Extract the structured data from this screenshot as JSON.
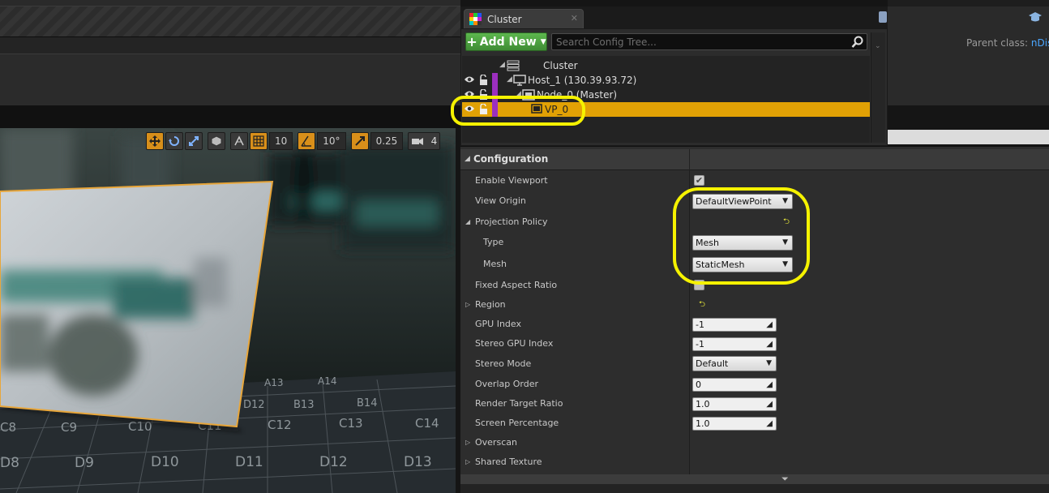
{
  "cluster_window": {
    "tab_title": "Cluster",
    "add_new_label": "Add New",
    "search_placeholder": "Search Config Tree...",
    "tree": [
      {
        "label": "Cluster",
        "depth": 0
      },
      {
        "label": "Host_1 (130.39.93.72)",
        "depth": 1
      },
      {
        "label": "Node_0 (Master)",
        "depth": 2
      },
      {
        "label": "VP_0",
        "depth": 3,
        "selected": true
      }
    ],
    "selected_color": "#e1a105",
    "swatch_color": "#9c2fbf"
  },
  "header_right": {
    "parent_class_label": "Parent class:",
    "parent_class_value": "nDis"
  },
  "viewport_toolbar": {
    "grid_snap": "10",
    "rotation_snap": "10°",
    "scale_snap": "0.25",
    "camera_speed": "4"
  },
  "viewport_floor": {
    "tiles": [
      "A13",
      "A14",
      "D12",
      "B13",
      "B14",
      "C8",
      "C9",
      "C10",
      "C11",
      "C12",
      "C13",
      "C14",
      "D8",
      "D9",
      "D10",
      "D11",
      "D12",
      "D13"
    ]
  },
  "details": {
    "section_title": "Configuration",
    "properties": {
      "enable_viewport": {
        "label": "Enable Viewport",
        "checked": true
      },
      "view_origin": {
        "label": "View Origin",
        "value": "DefaultViewPoint"
      },
      "projection_policy": {
        "label": "Projection Policy"
      },
      "type": {
        "label": "Type",
        "value": "Mesh"
      },
      "mesh": {
        "label": "Mesh",
        "value": "StaticMesh"
      },
      "fixed_aspect_ratio": {
        "label": "Fixed Aspect Ratio",
        "checked": false
      },
      "region": {
        "label": "Region"
      },
      "gpu_index": {
        "label": "GPU Index",
        "value": "-1"
      },
      "stereo_gpu_index": {
        "label": "Stereo GPU Index",
        "value": "-1"
      },
      "stereo_mode": {
        "label": "Stereo Mode",
        "value": "Default"
      },
      "overlap_order": {
        "label": "Overlap Order",
        "value": "0"
      },
      "render_target_ratio": {
        "label": "Render Target Ratio",
        "value": "1.0"
      },
      "screen_percentage": {
        "label": "Screen Percentage",
        "value": "1.0"
      },
      "overscan": {
        "label": "Overscan"
      },
      "shared_texture": {
        "label": "Shared Texture"
      }
    }
  },
  "annotation_color": "#f5f200"
}
